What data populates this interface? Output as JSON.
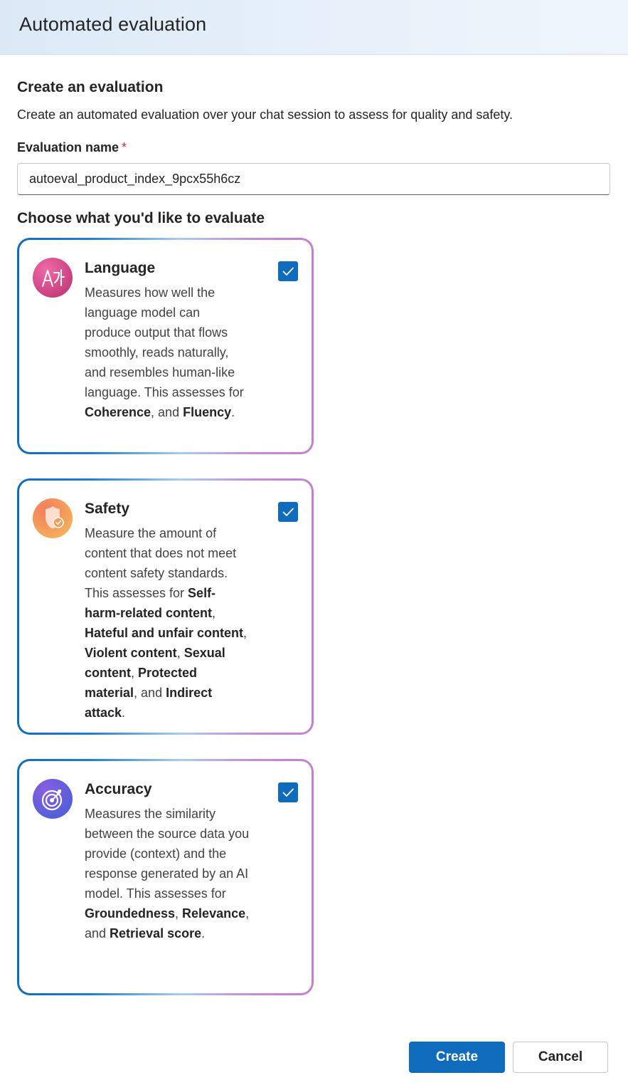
{
  "header": {
    "title": "Automated evaluation"
  },
  "form": {
    "section_title": "Create an evaluation",
    "section_description": "Create an automated evaluation over your chat session to assess for quality and safety.",
    "name_label": "Evaluation name",
    "name_required_marker": "*",
    "name_value": "autoeval_product_index_9pcx55h6cz",
    "choose_title": "Choose what you'd like to evaluate"
  },
  "cards": [
    {
      "title": "Language",
      "icon": "translate-icon",
      "checked": true,
      "description": [
        {
          "text": "Measures how well the language model can produce output that flows smoothly, reads naturally, and resembles human-like language. This assesses for "
        },
        {
          "text": "Coherence",
          "bold": true
        },
        {
          "text": ", and "
        },
        {
          "text": "Fluency",
          "bold": true
        },
        {
          "text": "."
        }
      ]
    },
    {
      "title": "Safety",
      "icon": "shield-check-icon",
      "checked": true,
      "description": [
        {
          "text": "Measure the amount of content that does not meet content safety standards. This assesses for "
        },
        {
          "text": "Self-harm-related content",
          "bold": true
        },
        {
          "text": ", "
        },
        {
          "text": "Hateful and unfair content",
          "bold": true
        },
        {
          "text": ", "
        },
        {
          "text": "Violent content",
          "bold": true
        },
        {
          "text": ", "
        },
        {
          "text": "Sexual content",
          "bold": true
        },
        {
          "text": ", "
        },
        {
          "text": "Protected material",
          "bold": true
        },
        {
          "text": ", and "
        },
        {
          "text": "Indirect attack",
          "bold": true
        },
        {
          "text": "."
        }
      ]
    },
    {
      "title": "Accuracy",
      "icon": "target-icon",
      "checked": true,
      "description": [
        {
          "text": "Measures the similarity between the source data you provide (context) and the response generated by an AI model. This assesses for "
        },
        {
          "text": "Groundedness",
          "bold": true
        },
        {
          "text": ", "
        },
        {
          "text": "Relevance",
          "bold": true
        },
        {
          "text": ", and "
        },
        {
          "text": "Retrieval score",
          "bold": true
        },
        {
          "text": "."
        }
      ]
    }
  ],
  "footer": {
    "create_label": "Create",
    "cancel_label": "Cancel"
  },
  "colors": {
    "primary": "#0f6cbd",
    "required": "#c4314b",
    "language_icon": "#d9478a",
    "safety_icon": "#f08a4b",
    "accuracy_icon": "#6a4bd8"
  }
}
